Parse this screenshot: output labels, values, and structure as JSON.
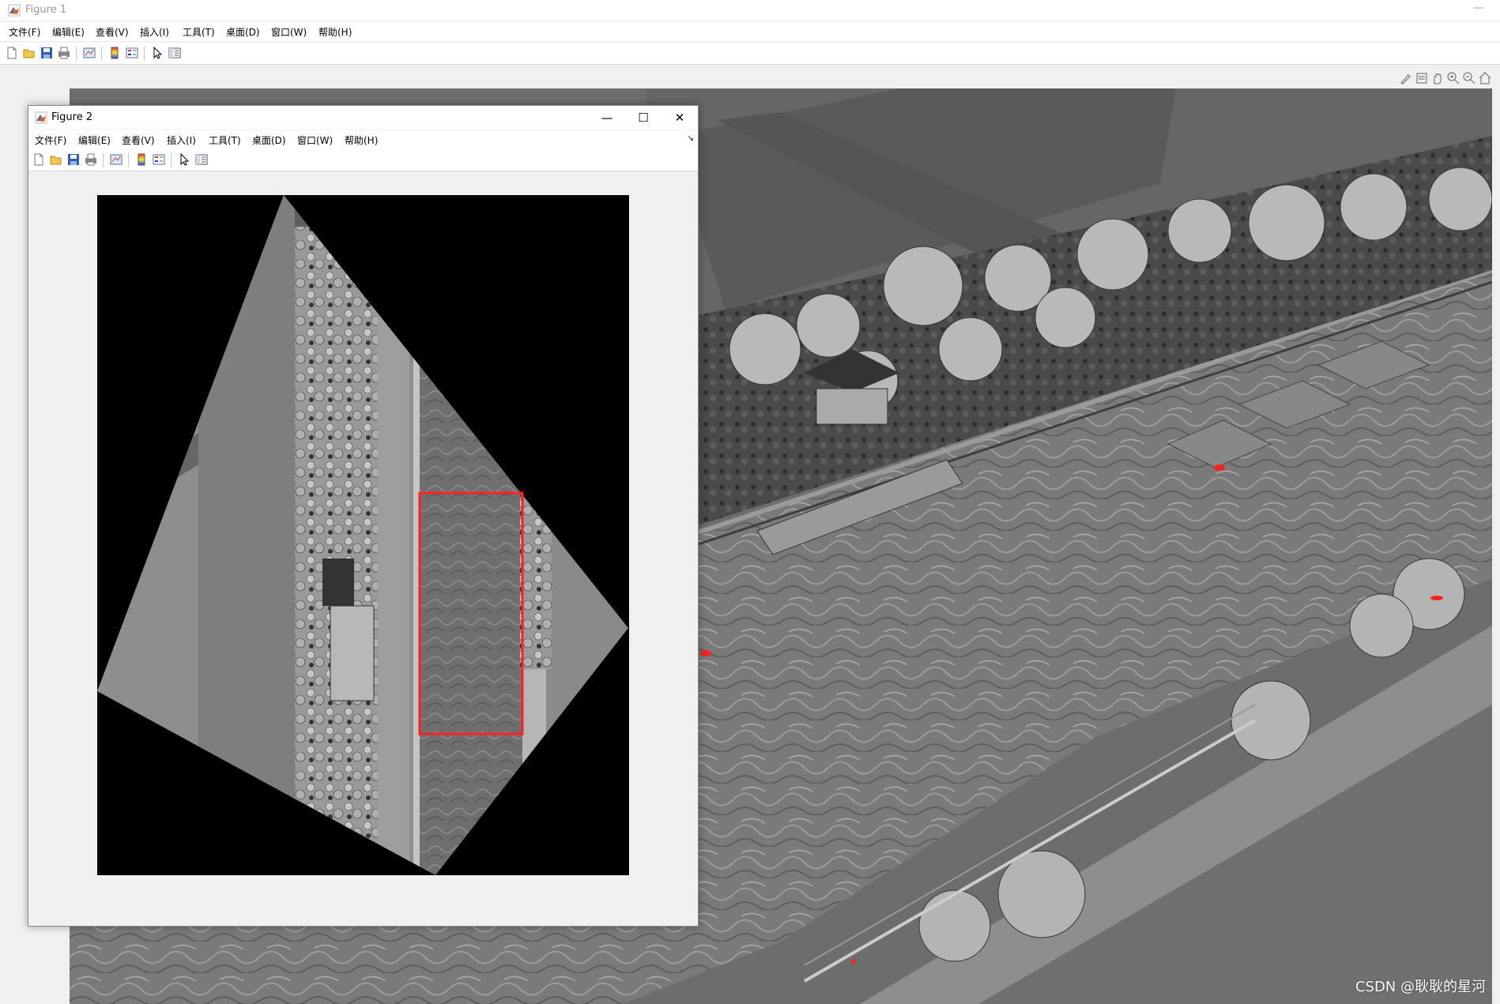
{
  "figure1": {
    "title": "Figure 1",
    "menu": [
      "文件(F)",
      "编辑(E)",
      "查看(V)",
      "插入(I)",
      "工具(T)",
      "桌面(D)",
      "窗口(W)",
      "帮助(H)"
    ],
    "toolbar_icons": [
      "new-figure-icon",
      "open-file-icon",
      "save-icon",
      "print-icon",
      "link-plot-icon",
      "insert-colorbar-icon",
      "insert-legend-icon",
      "pointer-icon",
      "property-inspector-icon"
    ],
    "axes_toolbar_icons": [
      "brush-icon",
      "data-tips-icon",
      "pan-icon",
      "zoom-in-icon",
      "zoom-out-icon",
      "home-icon"
    ],
    "minimize_glyph": "—"
  },
  "figure2": {
    "title": "Figure 2",
    "menu": [
      "文件(F)",
      "编辑(E)",
      "查看(V)",
      "插入(I)",
      "工具(T)",
      "桌面(D)",
      "窗口(W)",
      "帮助(H)"
    ],
    "toolbar_icons": [
      "new-figure-icon",
      "open-file-icon",
      "save-icon",
      "print-icon",
      "link-plot-icon",
      "insert-colorbar-icon",
      "insert-legend-icon",
      "pointer-icon",
      "property-inspector-icon"
    ],
    "window_controls": {
      "minimize": "—",
      "maximize": "☐",
      "close": "✕"
    },
    "dock_glyph": "↘"
  },
  "watermark": "CSDN @耿耿的星河",
  "colors": {
    "highlight_box": "#ff2020",
    "water": "#7b7b7b",
    "image_background": "#000000"
  }
}
